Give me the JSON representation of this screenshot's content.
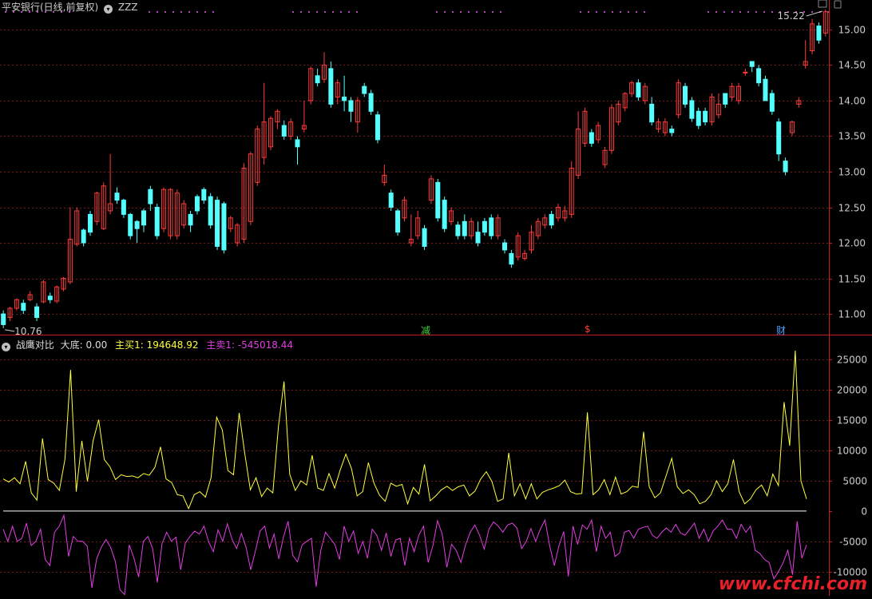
{
  "colors": {
    "up": "#ff3b3b",
    "down": "#54ffff",
    "axis": "#c81e1e",
    "grid": "#7a1b1b",
    "buy": "#ffff3c",
    "sell": "#e23ee2",
    "text": "#cccccc"
  },
  "header": {
    "stock_title": "平安银行(日线,前复权)",
    "indicator_name": "ZZZ"
  },
  "main": {
    "max_label": "15.22",
    "min_label": "10.76",
    "events": [
      {
        "label": "减",
        "color": "#3ad13a"
      },
      {
        "label": "$",
        "color": "#ff3b3b"
      },
      {
        "label": "财",
        "color": "#4aa0ff"
      }
    ]
  },
  "sub": {
    "name": "战鹰对比",
    "fields": [
      {
        "label": "大底: 0.00",
        "color": "#dddddd"
      },
      {
        "label": "主买1: 194648.92",
        "color": "#ffff3c"
      },
      {
        "label": "主卖1: -545018.44",
        "color": "#e23ee2"
      }
    ]
  },
  "watermark": "www.cfchi.com",
  "chart_data": [
    {
      "type": "candlestick",
      "ylim": [
        10.72,
        15.28
      ],
      "y_ticks": [
        "11.00",
        "11.50",
        "12.00",
        "12.50",
        "13.00",
        "13.50",
        "14.00",
        "14.50",
        "15.00"
      ],
      "grid": true,
      "open": [
        11.0,
        10.95,
        11.08,
        11.15,
        11.2,
        11.1,
        11.17,
        11.25,
        11.18,
        11.35,
        11.45,
        11.98,
        12.18,
        12.4,
        12.3,
        12.2,
        12.45,
        12.7,
        12.6,
        12.4,
        12.3,
        12.45,
        12.75,
        12.5,
        12.2,
        12.1,
        12.1,
        12.25,
        12.4,
        12.65,
        12.75,
        12.65,
        12.6,
        12.55,
        12.2,
        12.0,
        12.05,
        12.3,
        12.85,
        13.2,
        13.35,
        13.7,
        13.65,
        13.5,
        13.45,
        13.6,
        14.0,
        14.35,
        14.3,
        14.45,
        14.05,
        14.05,
        14.0,
        13.7,
        14.2,
        14.1,
        13.8,
        12.85,
        12.7,
        12.45,
        12.35,
        12.0,
        12.1,
        12.2,
        12.6,
        12.85,
        12.6,
        12.3,
        12.25,
        12.3,
        12.1,
        12.15,
        12.3,
        12.35,
        12.1,
        12.0,
        11.85,
        11.8,
        11.78,
        11.9,
        12.1,
        12.25,
        12.4,
        12.35,
        12.35,
        12.4,
        12.95,
        13.4,
        13.55,
        13.45,
        13.1,
        13.3,
        13.7,
        13.9,
        14.1,
        14.25,
        14.0,
        13.95,
        13.6,
        13.55,
        13.6,
        13.8,
        14.2,
        14.0,
        13.85,
        13.85,
        13.7,
        13.8,
        14.1,
        14.05,
        14.0,
        14.4,
        14.55,
        14.45,
        14.3,
        14.1,
        13.7,
        13.15,
        13.55,
        13.95,
        14.5,
        14.7,
        15.05,
        14.95
      ],
      "close": [
        10.85,
        11.08,
        11.2,
        11.05,
        11.27,
        10.95,
        11.45,
        11.2,
        11.38,
        11.5,
        12.05,
        12.45,
        12.0,
        12.15,
        12.7,
        12.8,
        12.55,
        12.6,
        12.4,
        12.1,
        12.2,
        12.25,
        12.55,
        12.1,
        12.75,
        12.75,
        12.7,
        12.55,
        12.25,
        12.45,
        12.6,
        12.25,
        11.95,
        11.9,
        12.35,
        12.25,
        13.05,
        13.25,
        13.6,
        13.7,
        13.75,
        13.85,
        13.5,
        13.7,
        13.35,
        13.65,
        14.45,
        14.25,
        14.5,
        13.95,
        14.25,
        14.0,
        13.85,
        14.0,
        14.1,
        13.85,
        13.45,
        12.95,
        12.5,
        12.15,
        12.6,
        12.05,
        12.35,
        11.95,
        12.9,
        12.35,
        12.2,
        12.45,
        12.1,
        12.1,
        12.3,
        12.0,
        12.15,
        12.1,
        12.35,
        11.9,
        11.7,
        12.1,
        11.85,
        12.15,
        12.3,
        12.35,
        12.25,
        12.5,
        12.45,
        13.05,
        13.6,
        13.85,
        13.4,
        13.65,
        13.3,
        13.9,
        13.95,
        14.1,
        14.25,
        14.05,
        14.2,
        13.7,
        13.7,
        13.7,
        13.55,
        14.25,
        13.95,
        13.75,
        13.65,
        13.7,
        14.05,
        13.95,
        13.95,
        14.2,
        14.2,
        14.4,
        14.48,
        14.25,
        14.0,
        13.85,
        13.25,
        13.0,
        13.7,
        14.0,
        14.55,
        15.08,
        14.85,
        15.25
      ],
      "high": [
        11.05,
        11.1,
        11.22,
        11.2,
        11.32,
        11.15,
        11.48,
        11.3,
        11.4,
        11.52,
        12.5,
        12.5,
        12.2,
        12.45,
        12.72,
        12.85,
        13.25,
        12.78,
        12.62,
        12.42,
        12.32,
        12.48,
        12.8,
        12.55,
        12.78,
        12.77,
        12.75,
        12.6,
        12.45,
        12.68,
        12.78,
        12.7,
        12.65,
        12.58,
        12.38,
        12.28,
        13.12,
        13.28,
        13.65,
        14.25,
        13.78,
        13.88,
        13.72,
        13.75,
        13.5,
        14.0,
        14.48,
        14.45,
        14.68,
        14.55,
        14.3,
        14.35,
        14.05,
        14.05,
        14.25,
        14.15,
        13.85,
        13.1,
        12.75,
        12.48,
        12.65,
        12.4,
        12.45,
        12.25,
        12.95,
        12.9,
        12.65,
        12.5,
        12.3,
        12.4,
        12.35,
        12.3,
        12.35,
        12.4,
        12.4,
        12.05,
        11.9,
        12.15,
        11.9,
        12.25,
        12.35,
        12.4,
        12.45,
        12.55,
        12.52,
        13.15,
        13.85,
        13.9,
        13.6,
        13.7,
        13.35,
        13.95,
        14.0,
        14.12,
        14.28,
        14.3,
        14.25,
        14.05,
        13.75,
        13.75,
        13.65,
        14.3,
        14.25,
        14.05,
        13.9,
        13.9,
        14.1,
        14.1,
        14.05,
        14.25,
        14.25,
        14.45,
        14.52,
        14.5,
        14.35,
        14.15,
        13.75,
        13.2,
        13.72,
        14.05,
        14.85,
        15.15,
        15.1,
        15.28
      ],
      "low": [
        10.8,
        10.9,
        11.05,
        11.0,
        11.18,
        10.9,
        11.15,
        11.15,
        11.15,
        11.32,
        11.42,
        11.95,
        11.95,
        12.1,
        12.25,
        12.18,
        12.4,
        12.55,
        12.35,
        12.05,
        12.0,
        12.15,
        12.45,
        12.05,
        12.15,
        12.05,
        12.05,
        12.2,
        12.15,
        12.4,
        12.55,
        12.2,
        11.9,
        11.85,
        12.15,
        11.95,
        12.0,
        12.25,
        12.8,
        13.1,
        13.3,
        13.6,
        13.45,
        13.45,
        13.1,
        13.55,
        13.95,
        14.2,
        14.25,
        13.9,
        13.95,
        13.85,
        13.7,
        13.55,
        14.05,
        13.8,
        13.4,
        12.8,
        12.45,
        12.1,
        12.3,
        11.95,
        12.05,
        11.9,
        12.55,
        12.3,
        12.15,
        12.25,
        12.05,
        12.05,
        12.05,
        11.95,
        12.1,
        12.05,
        12.05,
        11.85,
        11.65,
        11.75,
        11.75,
        11.85,
        12.05,
        12.2,
        12.2,
        12.3,
        12.3,
        12.35,
        12.9,
        13.35,
        13.35,
        13.4,
        13.05,
        13.25,
        13.65,
        13.85,
        14.05,
        14.0,
        13.95,
        13.65,
        13.55,
        13.5,
        13.5,
        13.75,
        13.9,
        13.7,
        13.6,
        13.65,
        13.65,
        13.75,
        13.9,
        14.0,
        13.95,
        14.35,
        14.4,
        14.2,
        14.2,
        13.8,
        13.15,
        12.95,
        13.5,
        13.9,
        14.45,
        14.65,
        14.8,
        14.9
      ]
    },
    {
      "type": "line",
      "ylim": [
        -14000,
        29000
      ],
      "y_ticks": [
        "25000",
        "20000",
        "15000",
        "10000",
        "5000",
        "0",
        "-5000",
        "-10000"
      ],
      "grid": true,
      "series": [
        {
          "name": "主买1",
          "values": [
            5300,
            4800,
            5500,
            4500,
            8200,
            3000,
            1800,
            12000,
            5200,
            4600,
            3400,
            8600,
            23300,
            3200,
            11600,
            4900,
            11600,
            15100,
            8500,
            7300,
            5200,
            6000,
            5700,
            5800,
            5500,
            6200,
            5900,
            7200,
            10600,
            5300,
            4700,
            2700,
            2500,
            400,
            2700,
            3200,
            2300,
            5500,
            15500,
            13400,
            6700,
            6000,
            16200,
            9500,
            3500,
            5500,
            2400,
            3800,
            3000,
            14000,
            21400,
            6100,
            3400,
            5000,
            4300,
            9200,
            3800,
            3400,
            6200,
            3800,
            6800,
            9400,
            7000,
            2500,
            3200,
            8000,
            4600,
            2600,
            1600,
            4600,
            4100,
            4400,
            1200,
            3900,
            2800,
            7700,
            1700,
            2500,
            3500,
            4100,
            3400,
            4000,
            4300,
            2500,
            3300,
            5300,
            6500,
            4900,
            1600,
            2000,
            9600,
            2500,
            4500,
            2000,
            4500,
            2000,
            3100,
            3500,
            3800,
            4200,
            5100,
            3200,
            2800,
            2900,
            16300,
            2700,
            3500,
            5200,
            2700,
            5600,
            2800,
            3200,
            4100,
            3900,
            13100,
            4000,
            2200,
            3000,
            5800,
            8700,
            4000,
            2900,
            3500,
            2700,
            1200,
            1600,
            2700,
            5000,
            3200,
            4500,
            8500,
            3200,
            1200,
            2000,
            3500,
            4300,
            2500,
            6100,
            4200,
            18000,
            10800,
            26500,
            5000,
            2000
          ]
        },
        {
          "name": "主卖1",
          "values": [
            -3000,
            -5000,
            -2500,
            -5000,
            -4500,
            -2000,
            -5700,
            -5000,
            -3000,
            -8000,
            -9000,
            -3500,
            -2500,
            -700,
            -7500,
            -4200,
            -5000,
            -5000,
            -5800,
            -12700,
            -7900,
            -6000,
            -4700,
            -6000,
            -8300,
            -13000,
            -13800,
            -5600,
            -7800,
            -10900,
            -5000,
            -4200,
            -6200,
            -11800,
            -5400,
            -3500,
            -5000,
            -4300,
            -9700,
            -5300,
            -4200,
            -3300,
            -3800,
            -2500,
            -5100,
            -6700,
            -3100,
            -5000,
            -2100,
            -4700,
            -6200,
            -3700,
            -6000,
            -9700,
            -6600,
            -3300,
            -2500,
            -6100,
            -3800,
            -7900,
            -4300,
            -1700,
            -7300,
            -8400,
            -5600,
            -5000,
            -4500,
            -12500,
            -6500,
            -3500,
            -4500,
            -5500,
            -8000,
            -2500,
            -5000,
            -3300,
            -7000,
            -5000,
            -7800,
            -3000,
            -4000,
            -6500,
            -3600,
            -7500,
            -4800,
            -4500,
            -9000,
            -4500,
            -6700,
            -4000,
            -2500,
            -8500,
            -5700,
            -1600,
            -3800,
            -9300,
            -5500,
            -6500,
            -8500,
            -5600,
            -3500,
            -2300,
            -4000,
            -6300,
            -3000,
            -1800,
            -2500,
            -3500,
            -2300,
            -2000,
            -2800,
            -6200,
            -5000,
            -2900,
            -5000,
            -3000,
            -1500,
            -5700,
            -9000,
            -5700,
            -3400,
            -10800,
            -2500,
            -5500,
            -2300,
            -3000,
            -1500,
            -6700,
            -2500,
            -4500,
            -3500,
            -7500,
            -6900,
            -3500,
            -3200,
            -4500,
            -3000,
            -2700,
            -2500,
            -4000,
            -4500,
            -3500,
            -2800,
            -3500,
            -2200,
            -3600,
            -4000,
            -3000,
            -2000,
            -4500,
            -3000,
            -5000,
            -3300,
            -2500,
            -1500,
            -3000,
            -3000,
            -4500,
            -2200,
            -3500,
            -2500,
            -6500,
            -7000,
            -8000,
            -8500,
            -11200,
            -10000,
            -8500,
            -6500,
            -10500,
            -1700,
            -7800,
            -5600
          ]
        }
      ]
    }
  ]
}
